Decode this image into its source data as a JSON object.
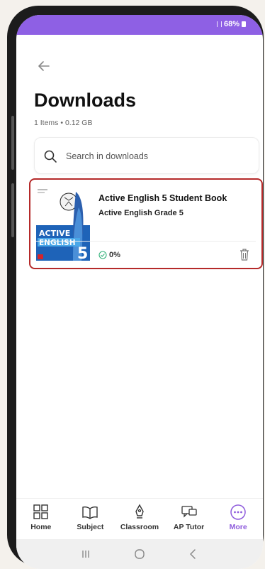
{
  "status": {
    "battery_text": "68%"
  },
  "header": {
    "title": "Downloads",
    "subtitle": "1 Items • 0.12 GB"
  },
  "search": {
    "placeholder": "Search in downloads"
  },
  "downloads": [
    {
      "title": "Active English 5 Student Book",
      "subtitle": "Active English Grade 5",
      "progress_text": "0%",
      "cover_title_1": "ACTIVE",
      "cover_title_2": "ENGLISH",
      "cover_grade": "5"
    }
  ],
  "nav": {
    "items": [
      {
        "label": "Home",
        "icon": "grid-icon"
      },
      {
        "label": "Subject",
        "icon": "book-icon"
      },
      {
        "label": "Classroom",
        "icon": "pen-icon"
      },
      {
        "label": "AP Tutor",
        "icon": "chat-icon"
      },
      {
        "label": "More",
        "icon": "more-icon",
        "active": true
      }
    ]
  },
  "colors": {
    "accent": "#8e60e4",
    "highlight_border": "#b52a2a"
  }
}
